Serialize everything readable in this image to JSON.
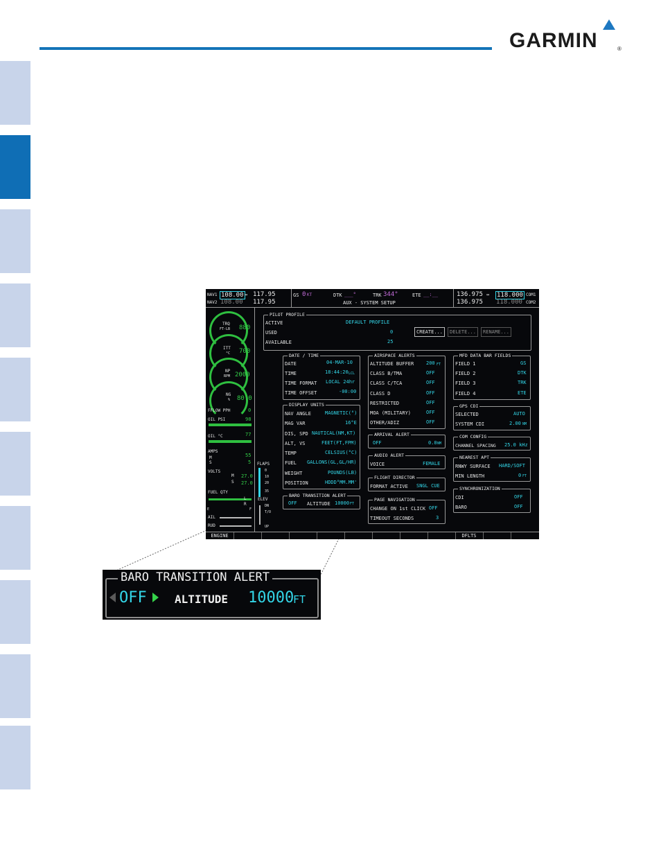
{
  "header": {
    "logo_text": "GARMIN",
    "logo_reg": "®",
    "accent_color": "#1474b8"
  },
  "side_tabs": {
    "count": 10,
    "active_index": 1
  },
  "mfd": {
    "nav1_active": "108.00",
    "nav1_standby": "117.95",
    "nav1_label": "NAV1",
    "nav2_active": "108.00",
    "nav2_standby": "117.95",
    "nav2_label": "NAV2",
    "gs_label": "GS",
    "gs_value": "0",
    "gs_unit": "KT",
    "dtk_label": "DTK",
    "dtk_value": "___°",
    "trk_label": "TRK",
    "trk_value": "344°",
    "ete_label": "ETE",
    "ete_value": "__:__",
    "page_title": "AUX - SYSTEM SETUP",
    "com1_active": "136.975",
    "com1_standby": "118.000",
    "com1_label": "COM1",
    "com2_active": "136.975",
    "com2_standby": "118.000",
    "com2_label": "COM2",
    "swap": "↔",
    "eis": {
      "trq_label": "TRQ",
      "trq_unit": "FT-LB",
      "trq_value": "880",
      "itt_label": "ITT",
      "itt_unit": "°C",
      "itt_value": "700",
      "np_label": "NP",
      "np_unit": "RPM",
      "np_value": "2000",
      "ng_label": "NG",
      "ng_unit": "%",
      "ng_value": "80.0",
      "fflow_label": "FFLOW PPH",
      "fflow_value": "0",
      "oilpsi_label": "OIL PSI",
      "oilpsi_value": "98",
      "oilc_label": "OIL °C",
      "oilc_value": "77",
      "amps_label": "AMPS",
      "amps_m": "M",
      "amps_s": "S",
      "amps_value1": "55",
      "amps_value2": "5",
      "volts_label": "VOLTS",
      "volts_m": "M",
      "volts_s": "S",
      "volts_value1": "27.0",
      "volts_value2": "27.0",
      "fuel_label": "FUEL QTY",
      "fuel_l": "L",
      "fuel_r": "R",
      "fuel_e": "E",
      "fuel_f": "F",
      "flaps_label": "FLAPS",
      "flaps_ticks": [
        "0",
        "10",
        "20",
        "35"
      ],
      "elev_label": "ELEV",
      "elev_dn": "DN",
      "elev_to": "T/O",
      "elev_up": "UP",
      "ail_label": "AIL",
      "rud_label": "RUD"
    },
    "pilot_profile": {
      "title": "PILOT PROFILE",
      "active_label": "ACTIVE",
      "active_value": "DEFAULT PROFILE",
      "used_label": "USED",
      "used_value": "0",
      "available_label": "AVAILABLE",
      "available_value": "25",
      "create": "CREATE...",
      "delete": "DELETE...",
      "rename": "RENAME..."
    },
    "date_time": {
      "title": "DATE / TIME",
      "date_label": "DATE",
      "date_value": "04-MAR-10",
      "time_label": "TIME",
      "time_value": "18:44:20",
      "time_unit": "LCL",
      "format_label": "TIME FORMAT",
      "format_value": "LOCAL 24hr",
      "offset_label": "TIME OFFSET",
      "offset_value": "-00:00"
    },
    "display_units": {
      "title": "DISPLAY UNITS",
      "nav_angle_label": "NAV ANGLE",
      "nav_angle_value": "MAGNETIC(°)",
      "mag_var_label": "MAG VAR",
      "mag_var_value": "16°E",
      "dis_spd_label": "DIS, SPD",
      "dis_spd_value": "NAUTICAL(NM,KT)",
      "alt_vs_label": "ALT, VS",
      "alt_vs_value": "FEET(FT,FPM)",
      "temp_label": "TEMP",
      "temp_value": "CELSIUS(°C)",
      "fuel_label": "FUEL",
      "fuel_value": "GALLONS(GL,GL/HR)",
      "weight_label": "WEIGHT",
      "weight_value": "POUNDS(LB)",
      "position_label": "POSITION",
      "position_value": "HDDD°MM.MM'"
    },
    "baro_alert": {
      "title": "BARO TRANSITION ALERT",
      "state": "OFF",
      "altitude_label": "ALTITUDE",
      "altitude_value": "10000",
      "altitude_unit": "FT"
    },
    "airspace_alerts": {
      "title": "AIRSPACE ALERTS",
      "buffer_label": "ALTITUDE BUFFER",
      "buffer_value": "200",
      "buffer_unit": "FT",
      "rows": [
        {
          "label": "CLASS B/TMA",
          "value": "OFF"
        },
        {
          "label": "CLASS C/TCA",
          "value": "OFF"
        },
        {
          "label": "CLASS D",
          "value": "OFF"
        },
        {
          "label": "RESTRICTED",
          "value": "OFF"
        },
        {
          "label": "MOA (MILITARY)",
          "value": "OFF"
        },
        {
          "label": "OTHER/ADIZ",
          "value": "OFF"
        }
      ]
    },
    "arrival_alert": {
      "title": "ARRIVAL ALERT",
      "state": "OFF",
      "value": "0.0",
      "unit": "NM"
    },
    "audio_alert": {
      "title": "AUDIO ALERT",
      "voice_label": "VOICE",
      "voice_value": "FEMALE"
    },
    "flight_director": {
      "title": "FLIGHT DIRECTOR",
      "format_label": "FORMAT ACTIVE",
      "format_value": "SNGL CUE"
    },
    "page_navigation": {
      "title": "PAGE NAVIGATION",
      "change_label": "CHANGE ON 1st CLICK",
      "change_value": "OFF",
      "timeout_label": "TIMEOUT SECONDS",
      "timeout_value": "3"
    },
    "mfd_data_bar": {
      "title": "MFD DATA BAR FIELDS",
      "rows": [
        {
          "label": "FIELD 1",
          "value": "GS"
        },
        {
          "label": "FIELD 2",
          "value": "DTK"
        },
        {
          "label": "FIELD 3",
          "value": "TRK"
        },
        {
          "label": "FIELD 4",
          "value": "ETE"
        }
      ]
    },
    "gps_cdi": {
      "title": "GPS CDI",
      "selected_label": "SELECTED",
      "selected_value": "AUTO",
      "system_label": "SYSTEM CDI",
      "system_value": "2.00",
      "system_unit": "NM"
    },
    "com_config": {
      "title": "COM CONFIG",
      "spacing_label": "CHANNEL SPACING",
      "spacing_value": "25.0 kHz"
    },
    "nearest_apt": {
      "title": "NEAREST APT",
      "surface_label": "RNWY SURFACE",
      "surface_value": "HARD/SOFT",
      "length_label": "MIN LENGTH",
      "length_value": "0",
      "length_unit": "FT"
    },
    "synchronization": {
      "title": "SYNCHRONIZATION",
      "cdi_label": "CDI",
      "cdi_value": "OFF",
      "baro_label": "BARO",
      "baro_value": "OFF"
    },
    "softkeys": {
      "engine": "ENGINE",
      "dflts": "DFLTS"
    }
  },
  "inset": {
    "title": "BARO TRANSITION ALERT",
    "state": "OFF",
    "altitude_label": "ALTITUDE",
    "altitude_value": "10000",
    "altitude_unit": "FT"
  }
}
